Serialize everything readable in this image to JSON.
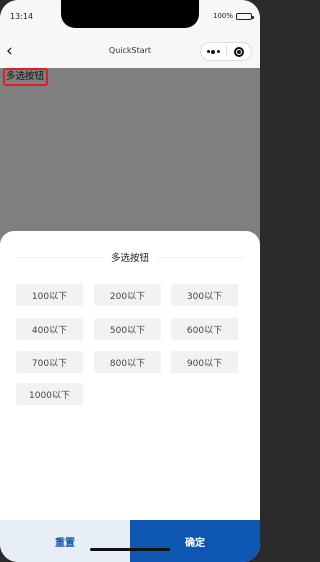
{
  "status_bar": {
    "time": "13:14",
    "battery_percent": "100%",
    "battery_level": 1.0
  },
  "nav": {
    "back_icon": "chevron-left-icon",
    "title": "QuickStart",
    "more_icon": "more-dots-icon",
    "close_icon": "target-close-icon"
  },
  "page": {
    "trigger_label": "多选按钮"
  },
  "popup": {
    "title": "多选按钮",
    "options": [
      "100以下",
      "200以下",
      "300以下",
      "400以下",
      "500以下",
      "600以下",
      "700以下",
      "800以下",
      "900以下",
      "1000以下"
    ],
    "reset_label": "重置",
    "confirm_label": "确定"
  },
  "colors": {
    "mask": "#7f7f7f",
    "trigger_border": "#e02020",
    "option_bg": "#f2f2f2",
    "reset_bg": "#e7eef6",
    "reset_text": "#1a5aa8",
    "confirm_bg": "#0d57b3"
  }
}
